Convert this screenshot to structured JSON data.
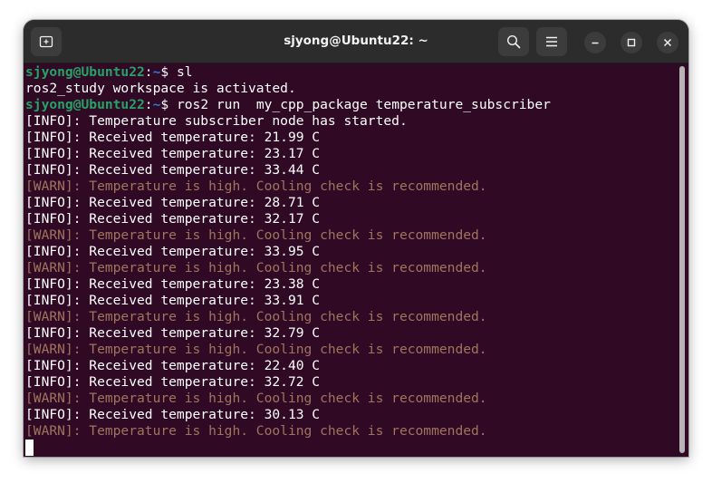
{
  "window": {
    "title": "sjyong@Ubuntu22: ~"
  },
  "header_icons": {
    "new_tab": "new-tab-icon",
    "search": "search-icon",
    "menu": "hamburger-menu-icon",
    "minimize": "minimize-icon",
    "maximize": "maximize-icon",
    "close": "close-icon"
  },
  "colors": {
    "terminal_bg": "#300a24",
    "prompt_user": "#26a269",
    "prompt_path": "#2a7bde",
    "warn_text": "#a0745e",
    "info_text": "#ffffff"
  },
  "terminal": {
    "lines": [
      {
        "type": "prompt",
        "user": "sjyong@Ubuntu22",
        "sep": ":",
        "path": "~",
        "dollar": "$ ",
        "cmd": "sl"
      },
      {
        "type": "output",
        "text": "ros2_study workspace is activated."
      },
      {
        "type": "prompt",
        "user": "sjyong@Ubuntu22",
        "sep": ":",
        "path": "~",
        "dollar": "$ ",
        "cmd": "ros2 run  my_cpp_package temperature_subscriber"
      },
      {
        "type": "info",
        "text": "[INFO]: Temperature subscriber node has started."
      },
      {
        "type": "info",
        "text": "[INFO]: Received temperature: 21.99 C"
      },
      {
        "type": "info",
        "text": "[INFO]: Received temperature: 23.17 C"
      },
      {
        "type": "info",
        "text": "[INFO]: Received temperature: 33.44 C"
      },
      {
        "type": "warn",
        "text": "[WARN]: Temperature is high. Cooling check is recommended."
      },
      {
        "type": "info",
        "text": "[INFO]: Received temperature: 28.71 C"
      },
      {
        "type": "info",
        "text": "[INFO]: Received temperature: 32.17 C"
      },
      {
        "type": "warn",
        "text": "[WARN]: Temperature is high. Cooling check is recommended."
      },
      {
        "type": "info",
        "text": "[INFO]: Received temperature: 33.95 C"
      },
      {
        "type": "warn",
        "text": "[WARN]: Temperature is high. Cooling check is recommended."
      },
      {
        "type": "info",
        "text": "[INFO]: Received temperature: 23.38 C"
      },
      {
        "type": "info",
        "text": "[INFO]: Received temperature: 33.91 C"
      },
      {
        "type": "warn",
        "text": "[WARN]: Temperature is high. Cooling check is recommended."
      },
      {
        "type": "info",
        "text": "[INFO]: Received temperature: 32.79 C"
      },
      {
        "type": "warn",
        "text": "[WARN]: Temperature is high. Cooling check is recommended."
      },
      {
        "type": "info",
        "text": "[INFO]: Received temperature: 22.40 C"
      },
      {
        "type": "info",
        "text": "[INFO]: Received temperature: 32.72 C"
      },
      {
        "type": "warn",
        "text": "[WARN]: Temperature is high. Cooling check is recommended."
      },
      {
        "type": "info",
        "text": "[INFO]: Received temperature: 30.13 C"
      },
      {
        "type": "warn",
        "text": "[WARN]: Temperature is high. Cooling check is recommended."
      }
    ]
  }
}
